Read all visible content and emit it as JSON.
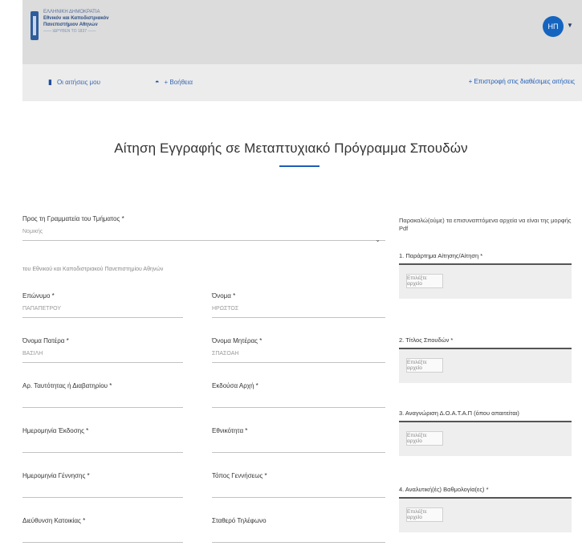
{
  "header": {
    "logo_lines": [
      "ΕΛΛΗΝΙΚΗ ΔΗΜΟΚΡΑΤΙΑ",
      "Εθνικόν και Καποδιστριακόν",
      "Πανεπιστήμιον Αθηνών",
      "—— ΙΔΡΥΘΕΝ ΤΟ 1837 ——"
    ],
    "avatar_initials": "ΗΠ",
    "avatar_color": "#1565c0"
  },
  "nav": {
    "link1": "Οι αιτήσεις μου",
    "link2": "+ Βοήθεια",
    "right_link": "+ Επιστροφή στις διαθέσιμες αιτήσεις",
    "accent_color": "#1f5db5"
  },
  "title": "Αίτηση Εγγραφής σε Μεταπτυχιακό Πρόγραμμα Σπουδών",
  "form": {
    "department": {
      "label": "Προς τη Γραμματεία του Τμήματος *",
      "value": "Νομικής"
    },
    "note": "του Εθνικού και Καποδιστριακού Πανεπιστημίου Αθηνών",
    "fields": [
      {
        "label": "Επώνυμο *",
        "value": "ΠΑΠΑΠΕΤΡΟΥ"
      },
      {
        "label": "Όνομα *",
        "value": "ΗΡΩΣΤΟΣ"
      },
      {
        "label": "Όνομα Πατέρα *",
        "value": "ΒΑΣΙΛΗ"
      },
      {
        "label": "Όνομα Μητέρας *",
        "value": "ΣΠΑΣΟΑΗ"
      },
      {
        "label": "Αρ. Ταυτότητας ή Διαβατηρίου *",
        "value": ""
      },
      {
        "label": "Εκδούσα Αρχή *",
        "value": ""
      },
      {
        "label": "Ημερομηνία Έκδοσης *",
        "value": ""
      },
      {
        "label": "Εθνικότητα *",
        "value": ""
      },
      {
        "label": "Ημερομηνία Γέννησης *",
        "value": ""
      },
      {
        "label": "Τόπος Γεννήσεως *",
        "value": ""
      },
      {
        "label": "Διεύθυνση Κατοικίας *",
        "value": ""
      },
      {
        "label": "Σταθερό Τηλέφωνο",
        "value": ""
      }
    ]
  },
  "uploads": {
    "intro": "Παρακαλώ(ούμε) τα επισυναπτόμενα αρχεία να είναι της μορφής Pdf",
    "button_label": "Επιλέξτε αρχείο",
    "items": [
      {
        "label": "1. Παράρτημα Αίτησης/Αίτηση *"
      },
      {
        "label": "2. Τίτλος Σπουδών *"
      },
      {
        "label": "3. Αναγνώριση Δ.Ο.Α.Τ.Α.Π (όπου απαιτείται)"
      },
      {
        "label": "4. Αναλυτική(ές) Βαθμολογία(ες) *"
      }
    ]
  }
}
